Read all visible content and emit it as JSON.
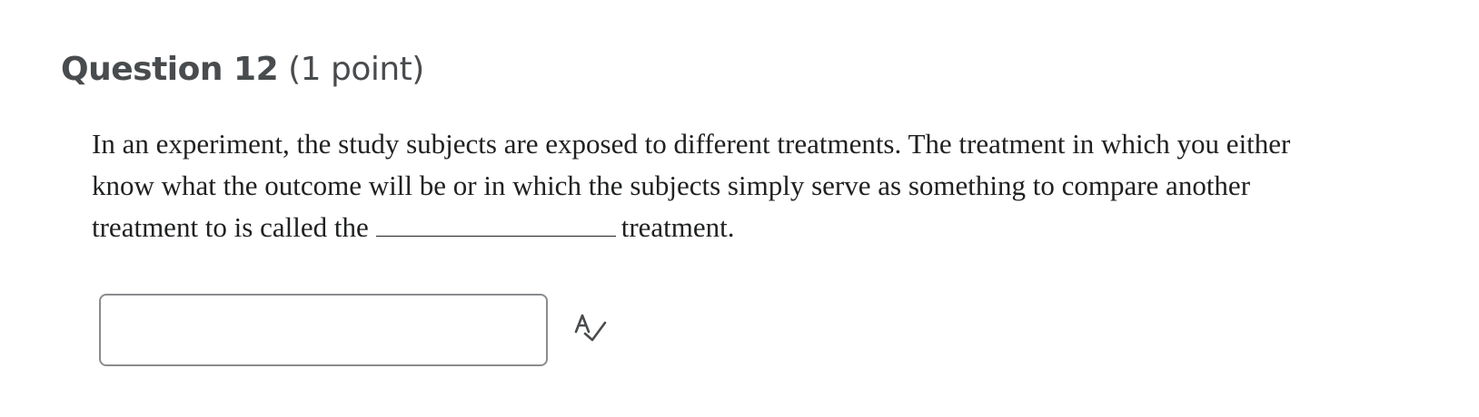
{
  "question": {
    "title": "Question 12",
    "points": "(1 point)",
    "text_line_1": "In an experiment, the study subjects are exposed to different treatments.  The treatment in which you either",
    "text_line_2": "know what the outcome will be or in which the subjects simply serve as something to compare another",
    "text_line_3_before_blank": "treatment to is called the",
    "text_line_3_after_blank": "treatment."
  },
  "answer": {
    "value": "",
    "placeholder": ""
  },
  "icons": {
    "spellcheck": "spellcheck-icon"
  }
}
